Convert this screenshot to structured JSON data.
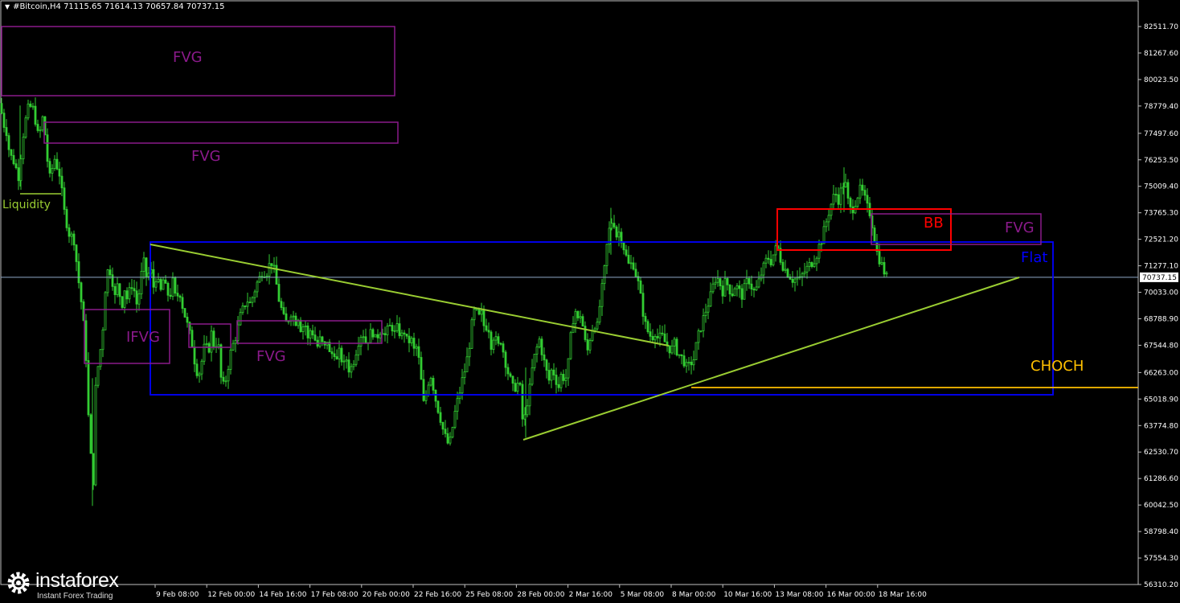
{
  "header": {
    "symbol_line": "#Bitcoin,H4  71115.65 71614.13 70657.84 70737.15"
  },
  "logo": {
    "brand": "instaforex",
    "tagline": "Instant Forex Trading"
  },
  "colors": {
    "background": "#000000",
    "candle": "#32cd32",
    "fvg": "#8b1a8b",
    "flat": "#0000ff",
    "bb": "#ff0000",
    "trendline": "#9acd32",
    "choch": "#ffc000",
    "price_line": "#8fa8c8"
  },
  "chart_data": {
    "type": "candlestick",
    "title": "#Bitcoin,H4",
    "ohlc_last": {
      "open": 71115.65,
      "high": 71614.13,
      "low": 70657.84,
      "close": 70737.15
    },
    "current_price": 70737.15,
    "current_price_label": "70737.15",
    "ylim": [
      56000,
      83500
    ],
    "y_ticks": [
      "82511.70",
      "81267.60",
      "80023.50",
      "78779.40",
      "77497.60",
      "76253.50",
      "75009.40",
      "73765.30",
      "72521.20",
      "71277.10",
      "70033.00",
      "68788.90",
      "67544.80",
      "66263.00",
      "65018.90",
      "63774.80",
      "62530.70",
      "61286.60",
      "60042.50",
      "58798.40",
      "57554.30",
      "56310.20"
    ],
    "x_ticks": [
      "9 Feb 08:00",
      "12 Feb 00:00",
      "14 Feb 16:00",
      "17 Feb 08:00",
      "20 Feb 00:00",
      "22 Feb 16:00",
      "25 Feb 08:00",
      "28 Feb 00:00",
      "2 Mar 16:00",
      "5 Mar 08:00",
      "8 Mar 00:00",
      "10 Mar 16:00",
      "13 Mar 08:00",
      "16 Mar 00:00",
      "18 Mar 16:00"
    ],
    "price_path": [
      [
        0,
        78900
      ],
      [
        4,
        78000
      ],
      [
        8,
        77600
      ],
      [
        12,
        76500
      ],
      [
        17,
        76200
      ],
      [
        23,
        75500
      ],
      [
        30,
        77800
      ],
      [
        36,
        78800
      ],
      [
        42,
        78600
      ],
      [
        48,
        77200
      ],
      [
        54,
        78400
      ],
      [
        58,
        76500
      ],
      [
        62,
        75400
      ],
      [
        68,
        76300
      ],
      [
        74,
        75600
      ],
      [
        80,
        73800
      ],
      [
        86,
        72800
      ],
      [
        92,
        72500
      ],
      [
        98,
        70500
      ],
      [
        103,
        69000
      ],
      [
        107,
        67000
      ],
      [
        110,
        64200
      ],
      [
        113,
        62300
      ],
      [
        116,
        61200
      ],
      [
        119,
        65500
      ],
      [
        123,
        66900
      ],
      [
        127,
        67800
      ],
      [
        131,
        70200
      ],
      [
        135,
        71300
      ],
      [
        139,
        70800
      ],
      [
        143,
        69800
      ],
      [
        147,
        70500
      ],
      [
        151,
        69300
      ],
      [
        155,
        70200
      ],
      [
        159,
        69600
      ],
      [
        163,
        70500
      ],
      [
        167,
        70100
      ],
      [
        171,
        69300
      ],
      [
        175,
        70700
      ],
      [
        179,
        71400
      ],
      [
        183,
        70600
      ],
      [
        187,
        71200
      ],
      [
        191,
        70300
      ],
      [
        195,
        70900
      ],
      [
        199,
        69900
      ],
      [
        203,
        70600
      ],
      [
        207,
        70100
      ],
      [
        211,
        69800
      ],
      [
        215,
        70500
      ],
      [
        219,
        69600
      ],
      [
        223,
        70200
      ],
      [
        227,
        69400
      ],
      [
        231,
        68800
      ],
      [
        235,
        68200
      ],
      [
        239,
        67600
      ],
      [
        243,
        66600
      ],
      [
        247,
        66100
      ],
      [
        251,
        66800
      ],
      [
        255,
        67600
      ],
      [
        259,
        67200
      ],
      [
        263,
        68100
      ],
      [
        267,
        67400
      ],
      [
        271,
        67900
      ],
      [
        275,
        66000
      ],
      [
        279,
        65500
      ],
      [
        283,
        66400
      ],
      [
        287,
        67200
      ],
      [
        291,
        67700
      ],
      [
        295,
        68200
      ],
      [
        299,
        68900
      ],
      [
        303,
        69300
      ],
      [
        307,
        69700
      ],
      [
        311,
        69500
      ],
      [
        315,
        69900
      ],
      [
        319,
        70400
      ],
      [
        323,
        70700
      ],
      [
        327,
        71100
      ],
      [
        331,
        70900
      ],
      [
        335,
        71300
      ],
      [
        339,
        71500
      ],
      [
        343,
        70600
      ],
      [
        347,
        69700
      ],
      [
        351,
        69100
      ],
      [
        355,
        68500
      ],
      [
        359,
        68800
      ],
      [
        363,
        69200
      ],
      [
        367,
        68600
      ],
      [
        371,
        68900
      ],
      [
        375,
        68200
      ],
      [
        379,
        68700
      ],
      [
        383,
        67800
      ],
      [
        387,
        68400
      ],
      [
        391,
        67900
      ],
      [
        395,
        67500
      ],
      [
        399,
        67900
      ],
      [
        403,
        67300
      ],
      [
        407,
        67800
      ],
      [
        411,
        66900
      ],
      [
        415,
        67400
      ],
      [
        419,
        66800
      ],
      [
        423,
        67300
      ],
      [
        427,
        66500
      ],
      [
        431,
        66900
      ],
      [
        435,
        66300
      ],
      [
        439,
        66700
      ],
      [
        443,
        67300
      ],
      [
        447,
        67900
      ],
      [
        451,
        68200
      ],
      [
        455,
        67700
      ],
      [
        459,
        67900
      ],
      [
        463,
        68300
      ],
      [
        467,
        67800
      ],
      [
        471,
        68100
      ],
      [
        475,
        68400
      ],
      [
        479,
        68000
      ],
      [
        483,
        68300
      ],
      [
        487,
        68500
      ],
      [
        491,
        68100
      ],
      [
        495,
        68400
      ],
      [
        499,
        67900
      ],
      [
        503,
        68200
      ],
      [
        507,
        67600
      ],
      [
        511,
        67900
      ],
      [
        515,
        67300
      ],
      [
        519,
        67500
      ],
      [
        523,
        66200
      ],
      [
        527,
        64800
      ],
      [
        531,
        65400
      ],
      [
        535,
        66300
      ],
      [
        539,
        65600
      ],
      [
        543,
        64800
      ],
      [
        547,
        64300
      ],
      [
        551,
        63600
      ],
      [
        555,
        63100
      ],
      [
        559,
        62800
      ],
      [
        563,
        63700
      ],
      [
        567,
        64600
      ],
      [
        571,
        65200
      ],
      [
        575,
        65900
      ],
      [
        579,
        66500
      ],
      [
        583,
        67300
      ],
      [
        587,
        68500
      ],
      [
        591,
        69300
      ],
      [
        595,
        68800
      ],
      [
        599,
        69000
      ],
      [
        603,
        68300
      ],
      [
        607,
        68600
      ],
      [
        611,
        67600
      ],
      [
        615,
        68100
      ],
      [
        619,
        67400
      ],
      [
        623,
        67800
      ],
      [
        627,
        67100
      ],
      [
        631,
        66400
      ],
      [
        635,
        65900
      ],
      [
        639,
        65400
      ],
      [
        643,
        65800
      ],
      [
        647,
        65500
      ],
      [
        651,
        63600
      ],
      [
        655,
        64700
      ],
      [
        659,
        65500
      ],
      [
        663,
        66700
      ],
      [
        667,
        67300
      ],
      [
        671,
        67800
      ],
      [
        675,
        67100
      ],
      [
        679,
        66400
      ],
      [
        683,
        65900
      ],
      [
        687,
        66500
      ],
      [
        691,
        66000
      ],
      [
        695,
        65600
      ],
      [
        699,
        66300
      ],
      [
        703,
        65800
      ],
      [
        707,
        66700
      ],
      [
        711,
        68300
      ],
      [
        715,
        69300
      ],
      [
        719,
        68700
      ],
      [
        723,
        69100
      ],
      [
        727,
        67800
      ],
      [
        731,
        67300
      ],
      [
        735,
        68100
      ],
      [
        739,
        68600
      ],
      [
        743,
        68400
      ],
      [
        747,
        69700
      ],
      [
        751,
        70700
      ],
      [
        755,
        72200
      ],
      [
        759,
        73200
      ],
      [
        763,
        73500
      ],
      [
        767,
        72700
      ],
      [
        771,
        72900
      ],
      [
        775,
        72300
      ],
      [
        779,
        71700
      ],
      [
        783,
        71200
      ],
      [
        787,
        71500
      ],
      [
        791,
        70900
      ],
      [
        795,
        70300
      ],
      [
        799,
        69300
      ],
      [
        803,
        68500
      ],
      [
        807,
        68100
      ],
      [
        811,
        67900
      ],
      [
        815,
        68200
      ],
      [
        819,
        67800
      ],
      [
        823,
        68000
      ],
      [
        827,
        67700
      ],
      [
        831,
        67500
      ],
      [
        835,
        67300
      ],
      [
        839,
        67600
      ],
      [
        843,
        67200
      ],
      [
        847,
        67000
      ],
      [
        851,
        66800
      ],
      [
        855,
        66400
      ],
      [
        859,
        66700
      ],
      [
        863,
        66900
      ],
      [
        867,
        67700
      ],
      [
        871,
        68300
      ],
      [
        875,
        68800
      ],
      [
        879,
        69300
      ],
      [
        883,
        69700
      ],
      [
        887,
        70300
      ],
      [
        891,
        70800
      ],
      [
        895,
        70500
      ],
      [
        899,
        70100
      ],
      [
        903,
        70600
      ],
      [
        907,
        70200
      ],
      [
        911,
        70000
      ],
      [
        915,
        70400
      ],
      [
        919,
        70100
      ],
      [
        923,
        69900
      ],
      [
        927,
        70300
      ],
      [
        931,
        70700
      ],
      [
        935,
        70300
      ],
      [
        939,
        70000
      ],
      [
        943,
        70400
      ],
      [
        947,
        70900
      ],
      [
        951,
        71300
      ],
      [
        955,
        71700
      ],
      [
        959,
        71500
      ],
      [
        963,
        71900
      ],
      [
        967,
        72200
      ],
      [
        971,
        71600
      ],
      [
        975,
        71200
      ],
      [
        979,
        71000
      ],
      [
        983,
        70800
      ],
      [
        987,
        70600
      ],
      [
        991,
        70700
      ],
      [
        995,
        70600
      ],
      [
        999,
        70900
      ],
      [
        1003,
        71100
      ],
      [
        1007,
        71300
      ],
      [
        1011,
        71500
      ],
      [
        1015,
        71700
      ],
      [
        1019,
        72200
      ],
      [
        1023,
        72600
      ],
      [
        1027,
        73200
      ],
      [
        1031,
        73800
      ],
      [
        1035,
        74300
      ],
      [
        1039,
        74700
      ],
      [
        1043,
        74400
      ],
      [
        1047,
        74900
      ],
      [
        1051,
        75300
      ],
      [
        1055,
        74300
      ],
      [
        1059,
        73800
      ],
      [
        1063,
        74200
      ],
      [
        1067,
        74600
      ],
      [
        1071,
        74900
      ],
      [
        1075,
        74500
      ],
      [
        1079,
        74000
      ],
      [
        1083,
        73700
      ],
      [
        1087,
        72800
      ],
      [
        1091,
        71900
      ],
      [
        1095,
        71500
      ],
      [
        1099,
        71100
      ],
      [
        1103,
        70737
      ]
    ]
  },
  "annotations": {
    "fvg1": "FVG",
    "fvg2": "FVG",
    "liquidity": "Liquidity",
    "ifvg": "IFVG",
    "fvg3": "FVG",
    "bb": "BB",
    "fvg4": "FVG",
    "flat": "Flat",
    "choch": "CHOCH"
  }
}
